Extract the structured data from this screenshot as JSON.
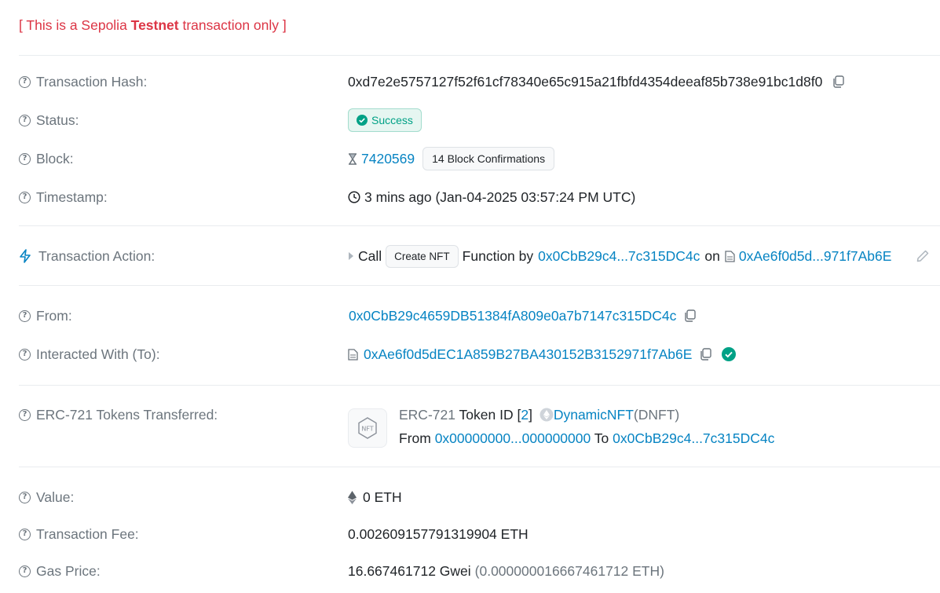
{
  "banner": {
    "prefix": "[ This is a Sepolia ",
    "strong": "Testnet",
    "suffix": " transaction only ]"
  },
  "labels": {
    "tx_hash": "Transaction Hash:",
    "status": "Status:",
    "block": "Block:",
    "timestamp": "Timestamp:",
    "tx_action": "Transaction Action:",
    "from": "From:",
    "interacted_with": "Interacted With (To):",
    "erc721": "ERC-721 Tokens Transferred:",
    "value": "Value:",
    "tx_fee": "Transaction Fee:",
    "gas_price": "Gas Price:"
  },
  "values": {
    "tx_hash": "0xd7e2e5757127f52f61cf78340e65c915a21fbfd4354deeaf85b738e91bc1d8f0",
    "status": "Success",
    "block_number": "7420569",
    "block_confirmations": "14 Block Confirmations",
    "timestamp": "3 mins ago (Jan-04-2025 03:57:24 PM UTC)",
    "action": {
      "call": "Call",
      "function_name": "Create NFT",
      "function_by": "Function by",
      "by_address": "0x0CbB29c4...7c315DC4c",
      "on": "on",
      "contract": "0xAe6f0d5d...971f7Ab6E"
    },
    "from": "0x0CbB29c4659DB51384fA809e0a7b7147c315DC4c",
    "to": "0xAe6f0d5dEC1A859B27BA430152B3152971f7Ab6E",
    "erc721": {
      "standard": "ERC-721",
      "token_id_label": "Token ID",
      "open_bracket": "[",
      "token_id": "2",
      "close_bracket": "]",
      "token_name": "DynamicNFT",
      "token_symbol": "(DNFT)",
      "from_label": "From",
      "from_addr": "0x00000000...000000000",
      "to_label": "To",
      "to_addr": "0x0CbB29c4...7c315DC4c",
      "icon_text": "NFT"
    },
    "value": "0 ETH",
    "tx_fee": "0.002609157791319904 ETH",
    "gas_price_gwei": "16.667461712 Gwei",
    "gas_price_eth": "(0.000000016667461712 ETH)"
  },
  "colors": {
    "link": "#0784c3",
    "danger": "#dc3545",
    "success": "#00a186",
    "muted": "#6c757d"
  },
  "icons": {
    "help": "question-circle-icon",
    "copy": "copy-icon",
    "hourglass": "hourglass-icon",
    "clock": "clock-icon",
    "lightning": "lightning-icon",
    "contract": "file-icon",
    "edit": "pencil-icon",
    "verified": "check-circle-icon",
    "eth": "ethereum-icon"
  }
}
